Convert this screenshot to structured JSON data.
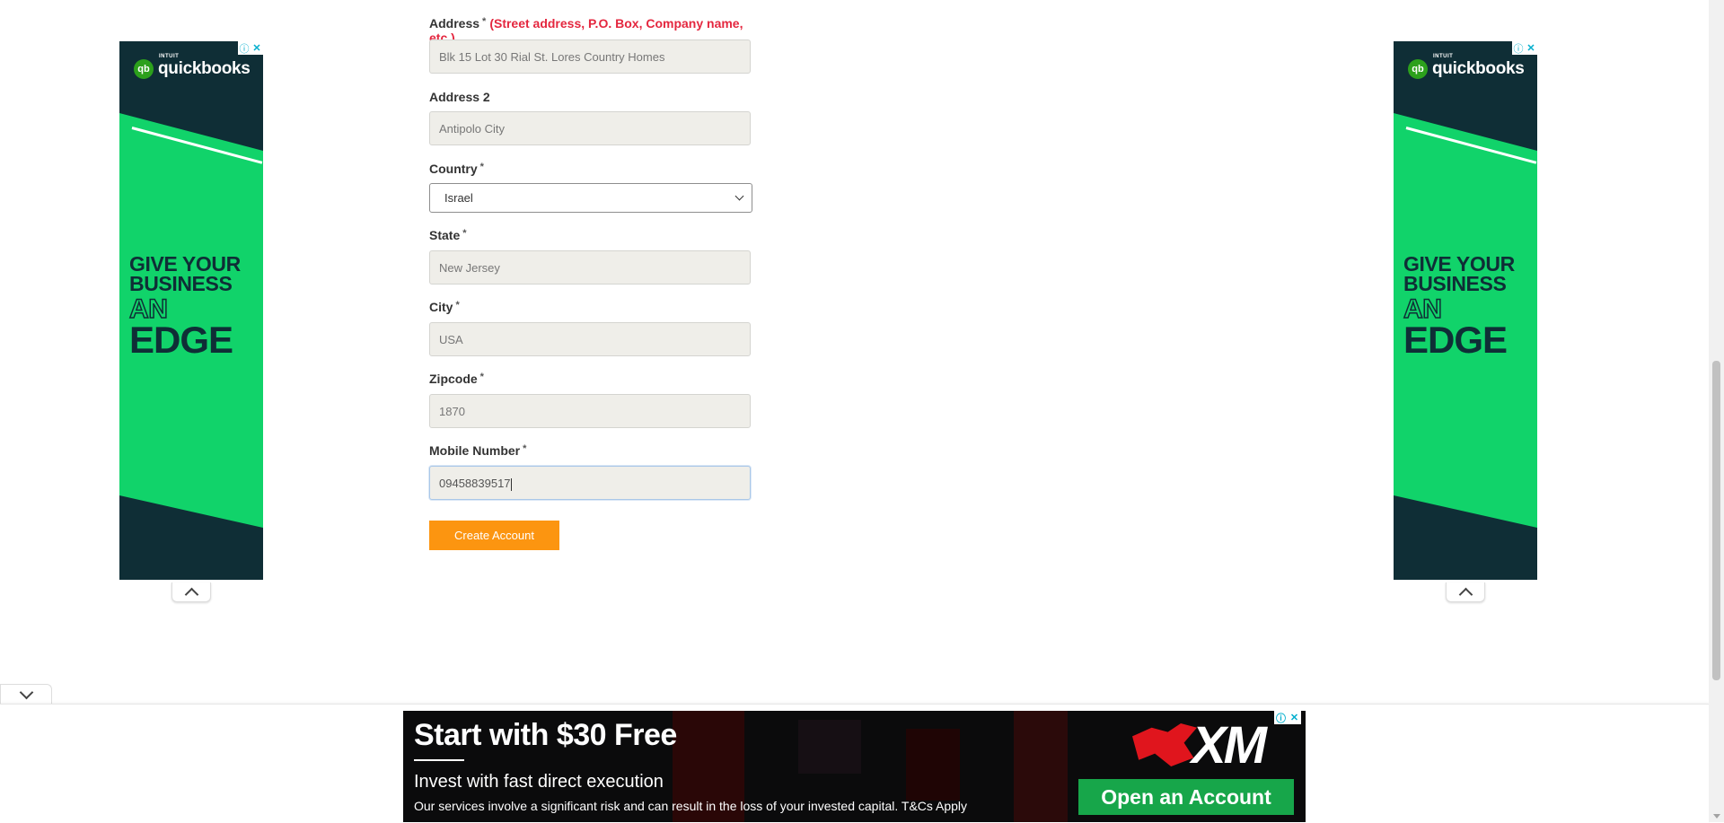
{
  "form": {
    "address_label": "Address",
    "address_required": "*",
    "address_hint": "(Street address, P.O. Box, Company name, etc.)",
    "address_value": "Blk 15 Lot 30 Rial St. Lores Country Homes",
    "address2_label": "Address 2",
    "address2_value": "Antipolo City",
    "country_label": "Country",
    "country_required": "*",
    "country_value": "Israel",
    "state_label": "State",
    "state_required": "*",
    "state_value": "New Jersey",
    "city_label": "City",
    "city_required": "*",
    "city_value": "USA",
    "zipcode_label": "Zipcode",
    "zipcode_required": "*",
    "zipcode_value": "1870",
    "mobile_label": "Mobile Number",
    "mobile_required": "*",
    "mobile_value": "09458839517",
    "submit_label": "Create Account"
  },
  "side_ad": {
    "brand_small": "INTUIT",
    "brand": "quickbooks",
    "brand_mark": "qb",
    "line1": "GIVE YOUR",
    "line2": "BUSINESS",
    "line3": "AN",
    "line4": "EDGE",
    "colors": {
      "dark": "#0f2e36",
      "green": "#11d36a"
    }
  },
  "bottom_ad": {
    "headline": "Start with $30 Free",
    "subline": "Invest with fast direct execution",
    "disclaimer": "Our services involve a significant risk and can result in the loss of your invested capital. T&Cs Apply",
    "brand": "XM",
    "cta": "Open an Account"
  },
  "ad_controls": {
    "info": "ⓘ",
    "close": "✕"
  },
  "colors": {
    "accent_button": "#fc9510",
    "required_hint": "#e4273f"
  }
}
